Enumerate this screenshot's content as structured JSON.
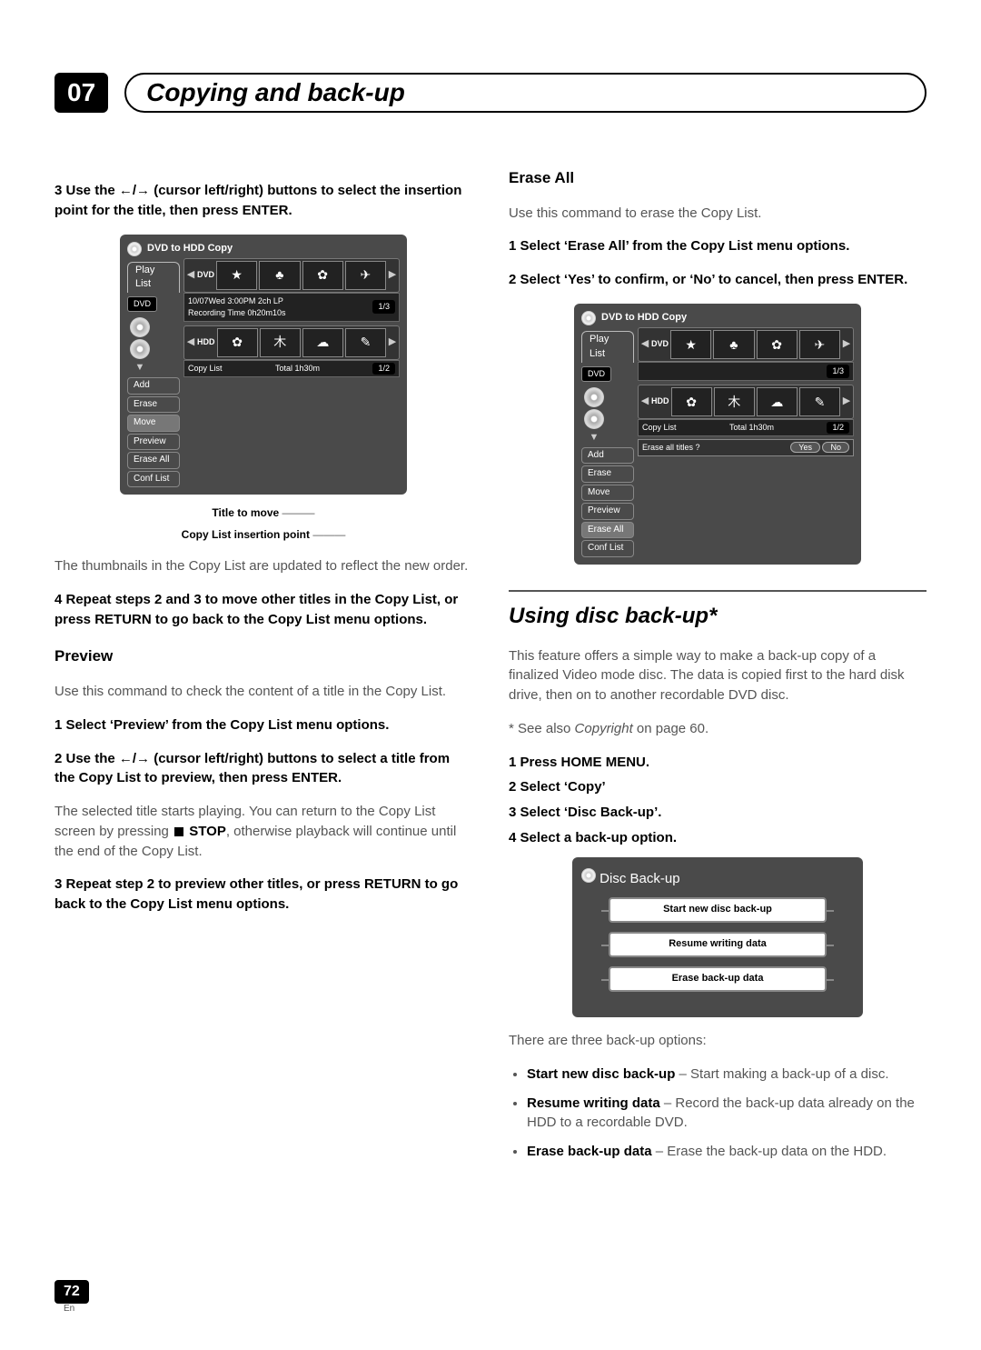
{
  "chapter_num": "07",
  "chapter_title": "Copying and back-up",
  "left": {
    "step3": "3   Use the ←/→ (cursor left/right) buttons to select the insertion point for the title, then press ENTER.",
    "fig1": {
      "top_title": "DVD to HDD Copy",
      "tab": "Play List",
      "badge": "DVD",
      "hdd_label": "HDD",
      "info_line_1": "10/07Wed 3:00PM  2ch  LP",
      "info_line_2": "Recording Time         0h20m10s",
      "page_upper": "1/3",
      "menu": [
        "Add",
        "Erase",
        "Move",
        "Preview",
        "Erase All",
        "Conf List"
      ],
      "selected_menu_index": 2,
      "copy_list_label": "Copy List",
      "total_label": "Total  1h30m",
      "page_lower": "1/2",
      "caption_title": "Title to move",
      "caption_point": "Copy List insertion point"
    },
    "after_fig1": "The thumbnails in the Copy List are updated to reflect the new order.",
    "step4": "4   Repeat steps 2 and 3 to move other titles in the Copy List, or press RETURN to go back to the Copy List menu options.",
    "preview_head": "Preview",
    "preview_intro": "Use this command to check the content of a title in the Copy List.",
    "p_step1": "1   Select ‘Preview’ from the Copy List menu options.",
    "p_step2": "2   Use the ←/→ (cursor left/right) buttons to select a title from the Copy List to preview, then press ENTER.",
    "p_after2a": "The selected title starts playing. You can return to the Copy List screen by pressing ",
    "p_stop": "STOP",
    "p_after2b": ", otherwise playback will continue until the end of the Copy List.",
    "p_step3": "3   Repeat step 2 to preview other titles, or press RETURN to go back to the Copy List menu options."
  },
  "right": {
    "erase_head": "Erase All",
    "erase_intro": "Use this command to erase the Copy List.",
    "e_step1": "1   Select ‘Erase All’ from the Copy List menu options.",
    "e_step2": "2   Select ‘Yes’ to confirm, or ‘No’ to cancel, then press ENTER.",
    "fig2": {
      "top_title": "DVD to HDD Copy",
      "tab": "Play List",
      "badge": "DVD",
      "hdd_label": "HDD",
      "page_upper": "1/3",
      "menu": [
        "Add",
        "Erase",
        "Move",
        "Preview",
        "Erase All",
        "Conf List"
      ],
      "selected_menu_index": 4,
      "copy_list_label": "Copy List",
      "total_label": "Total  1h30m",
      "page_lower": "1/2",
      "dialog_q": "Erase all titles ?",
      "yes": "Yes",
      "no": "No"
    },
    "backup_head": "Using disc back-up*",
    "backup_intro": "This feature offers a simple way to make a back-up copy of a  finalized Video mode disc. The data is copied first to the hard disk drive, then on to another recordable DVD disc.",
    "backup_note_a": "* See also ",
    "backup_note_i": "Copyright",
    "backup_note_b": " on page 60.",
    "b_step1": "1   Press HOME MENU.",
    "b_step2": "2   Select ‘Copy’",
    "b_step3": "3   Select ‘Disc Back-up’.",
    "b_step4": "4   Select a back-up option.",
    "menu_title": "Disc Back-up",
    "menu_items": [
      "Start new disc back-up",
      "Resume writing data",
      "Erase back-up data"
    ],
    "options_intro": "There are three back-up options:",
    "opt1_b": "Start new disc back-up",
    "opt1_t": " – Start making a back-up of a disc.",
    "opt2_b": "Resume writing data",
    "opt2_t": " – Record the back-up data already on the HDD to a recordable DVD.",
    "opt3_b": "Erase back-up data",
    "opt3_t": " – Erase the back-up data on the HDD."
  },
  "page_number": "72",
  "lang": "En"
}
